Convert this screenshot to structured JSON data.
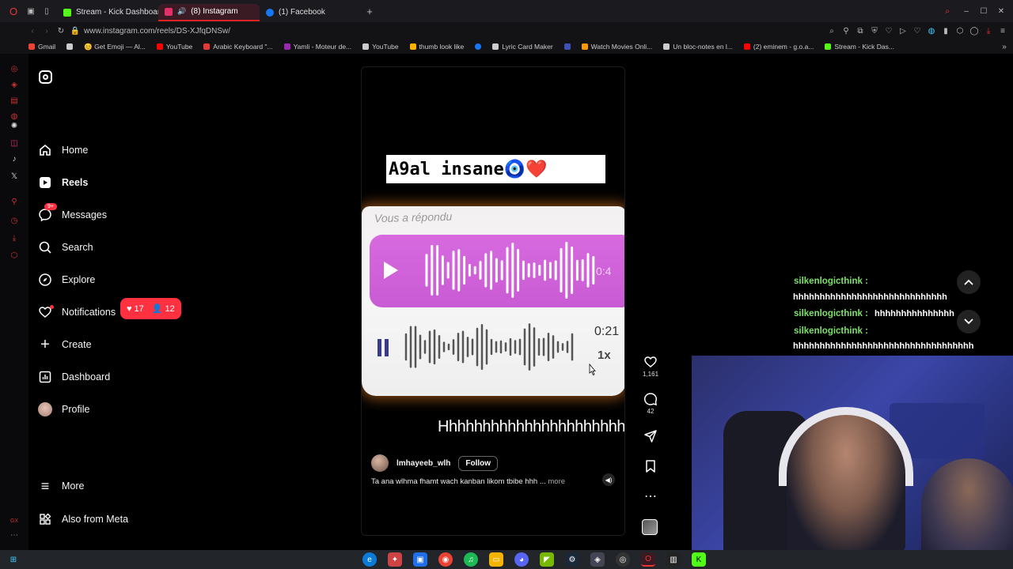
{
  "browser": {
    "tabs": [
      {
        "label": "Stream - Kick Dashboard",
        "color": "#53fc18"
      },
      {
        "label": "(8) Instagram",
        "color": "#e1306c",
        "active": true
      },
      {
        "label": "(1) Facebook",
        "color": "#1877f2"
      }
    ],
    "url": "www.instagram.com/reels/DS-XJfqDNSw/",
    "bookmarks": [
      {
        "label": "Gmail",
        "color": "#ea4335"
      },
      {
        "label": "",
        "color": "#cccccc"
      },
      {
        "label": "😊 Get Emoji — Al...",
        "color": "#f4c20d"
      },
      {
        "label": "YouTube",
        "color": "#ff0000"
      },
      {
        "label": "Arabic Keyboard \"...",
        "color": "#e53935"
      },
      {
        "label": "Yamli - Moteur de...",
        "color": "#9c27b0"
      },
      {
        "label": "YouTube",
        "color": "#cccccc"
      },
      {
        "label": "thumb look like",
        "color": "#ffb300"
      },
      {
        "label": "",
        "color": "#1877f2"
      },
      {
        "label": "Lyric Card Maker",
        "color": "#cccccc"
      },
      {
        "label": "",
        "color": "#3f51b5"
      },
      {
        "label": "Watch Movies Onli...",
        "color": "#ff9800"
      },
      {
        "label": "Un bloc-notes en l...",
        "color": "#cccccc"
      },
      {
        "label": "(2) eminem - g.o.a...",
        "color": "#ff0000"
      },
      {
        "label": "Stream - Kick Das...",
        "color": "#53fc18"
      }
    ]
  },
  "nav": {
    "home": "Home",
    "reels": "Reels",
    "messages": "Messages",
    "messages_badge": "9+",
    "search": "Search",
    "explore": "Explore",
    "notifications": "Notifications",
    "notif_likes": "17",
    "notif_follows": "12",
    "create": "Create",
    "dashboard": "Dashboard",
    "profile": "Profile",
    "more": "More",
    "meta": "Also from Meta"
  },
  "reel": {
    "caption": "A9al insane🧿❤️",
    "replied_label": "Vous a répondu",
    "top_duration": "0:4",
    "bottom_duration": "0:21",
    "speed": "1x",
    "overlay_text": "Hhhhhhhhhhhhhhhhhhhhhh",
    "username": "lmhayeeb_wlh",
    "follow": "Follow",
    "description": "Ta ana wlhma fhamt wach kanban likom tbibe hhh ...",
    "more": "more",
    "likes": "1,161",
    "comments": "42"
  },
  "chat": [
    {
      "user": "silkenlogicthink :",
      "message": "hhhhhhhhhhhhhhhhhhhhhhhhhhhhh"
    },
    {
      "user": "silkenlogicthink :",
      "message": "hhhhhhhhhhhhhhh"
    },
    {
      "user": "silkenlogicthink :",
      "message": "hhhhhhhhhhhhhhhhhhhhhhhhhhhhhhhhhh"
    }
  ],
  "colors": {
    "accent": "#e8173f",
    "chat_name": "#7ee06a",
    "purple": "#cf5fd9"
  }
}
